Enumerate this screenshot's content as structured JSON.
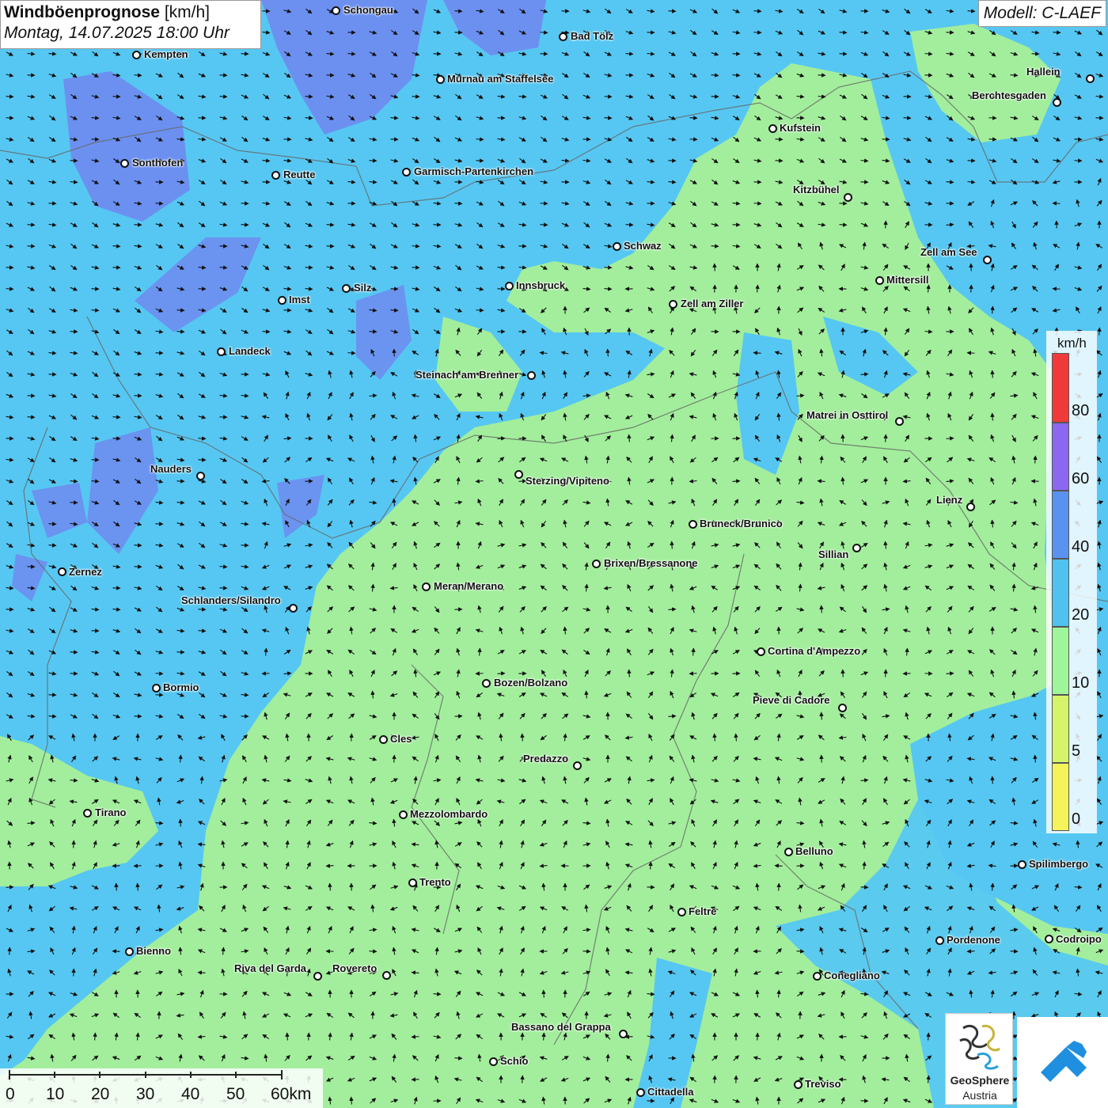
{
  "title": {
    "main": "Windböenprognose",
    "unit": "[km/h]",
    "datetime": "Montag, 14.07.2025 18:00 Uhr"
  },
  "model_label": "Modell: C-LAEF",
  "colors": {
    "band_0_5": "#f4f45a",
    "band_5_10": "#d4f56a",
    "band_10_20": "#9ef59a",
    "band_20_40": "#52c8f5",
    "band_40_60": "#5a92f0",
    "band_60_80": "#8a68f0",
    "band_80_plus": "#f03a3a",
    "background_field": "#56c7f2",
    "low_wind_field": "#a2ee9c",
    "strong_wind_field": "#6f8af0"
  },
  "legend": {
    "unit": "km/h",
    "labels": [
      "80",
      "60",
      "40",
      "20",
      "10",
      "5",
      "0"
    ]
  },
  "scale_bar": {
    "labels": [
      "0",
      "10",
      "20",
      "30",
      "40",
      "50",
      "60km"
    ]
  },
  "cities": [
    {
      "name": "Schongau"
    },
    {
      "name": "Bad Tölz"
    },
    {
      "name": "Kempten"
    },
    {
      "name": "Murnau am Staffelsee"
    },
    {
      "name": "Hallein"
    },
    {
      "name": "Berchtesgaden"
    },
    {
      "name": "Kufstein"
    },
    {
      "name": "Sonthofen"
    },
    {
      "name": "Reutte"
    },
    {
      "name": "Garmisch-Partenkirchen"
    },
    {
      "name": "Kitzbühel"
    },
    {
      "name": "Schwaz"
    },
    {
      "name": "Zell am See"
    },
    {
      "name": "Innsbruck"
    },
    {
      "name": "Mittersill"
    },
    {
      "name": "Silz"
    },
    {
      "name": "Imst"
    },
    {
      "name": "Zell am Ziller"
    },
    {
      "name": "Landeck"
    },
    {
      "name": "Steinach am Brenner"
    },
    {
      "name": "Matrei in Osttirol"
    },
    {
      "name": "Nauders"
    },
    {
      "name": "Sterzing/Vipiteno"
    },
    {
      "name": "Lienz"
    },
    {
      "name": "Bruneck/Brunico"
    },
    {
      "name": "Sillian"
    },
    {
      "name": "Zernez"
    },
    {
      "name": "Brixen/Bressanone"
    },
    {
      "name": "Meran/Merano"
    },
    {
      "name": "Schlanders/Silandro"
    },
    {
      "name": "Cortina d'Ampezzo"
    },
    {
      "name": "Bozen/Bolzano"
    },
    {
      "name": "Bormio"
    },
    {
      "name": "Pieve di Cadore"
    },
    {
      "name": "Cles"
    },
    {
      "name": "Predazzo"
    },
    {
      "name": "Tirano"
    },
    {
      "name": "Mezzolombardo"
    },
    {
      "name": "Belluno"
    },
    {
      "name": "Spilimbergo"
    },
    {
      "name": "Trento"
    },
    {
      "name": "Feltre"
    },
    {
      "name": "Pordenone"
    },
    {
      "name": "Codroipo"
    },
    {
      "name": "Bienno"
    },
    {
      "name": "Riva del Garda"
    },
    {
      "name": "Rovereto"
    },
    {
      "name": "Conegliano"
    },
    {
      "name": "Bassano del Grappa"
    },
    {
      "name": "Schio"
    },
    {
      "name": "Treviso"
    },
    {
      "name": "Cittadella"
    }
  ],
  "logo": {
    "name_line1": "GeoSphere",
    "name_line2": "Austria",
    "logo_icon": "geosphere-swirl-icon",
    "app_icon": "weather-app-icon"
  }
}
